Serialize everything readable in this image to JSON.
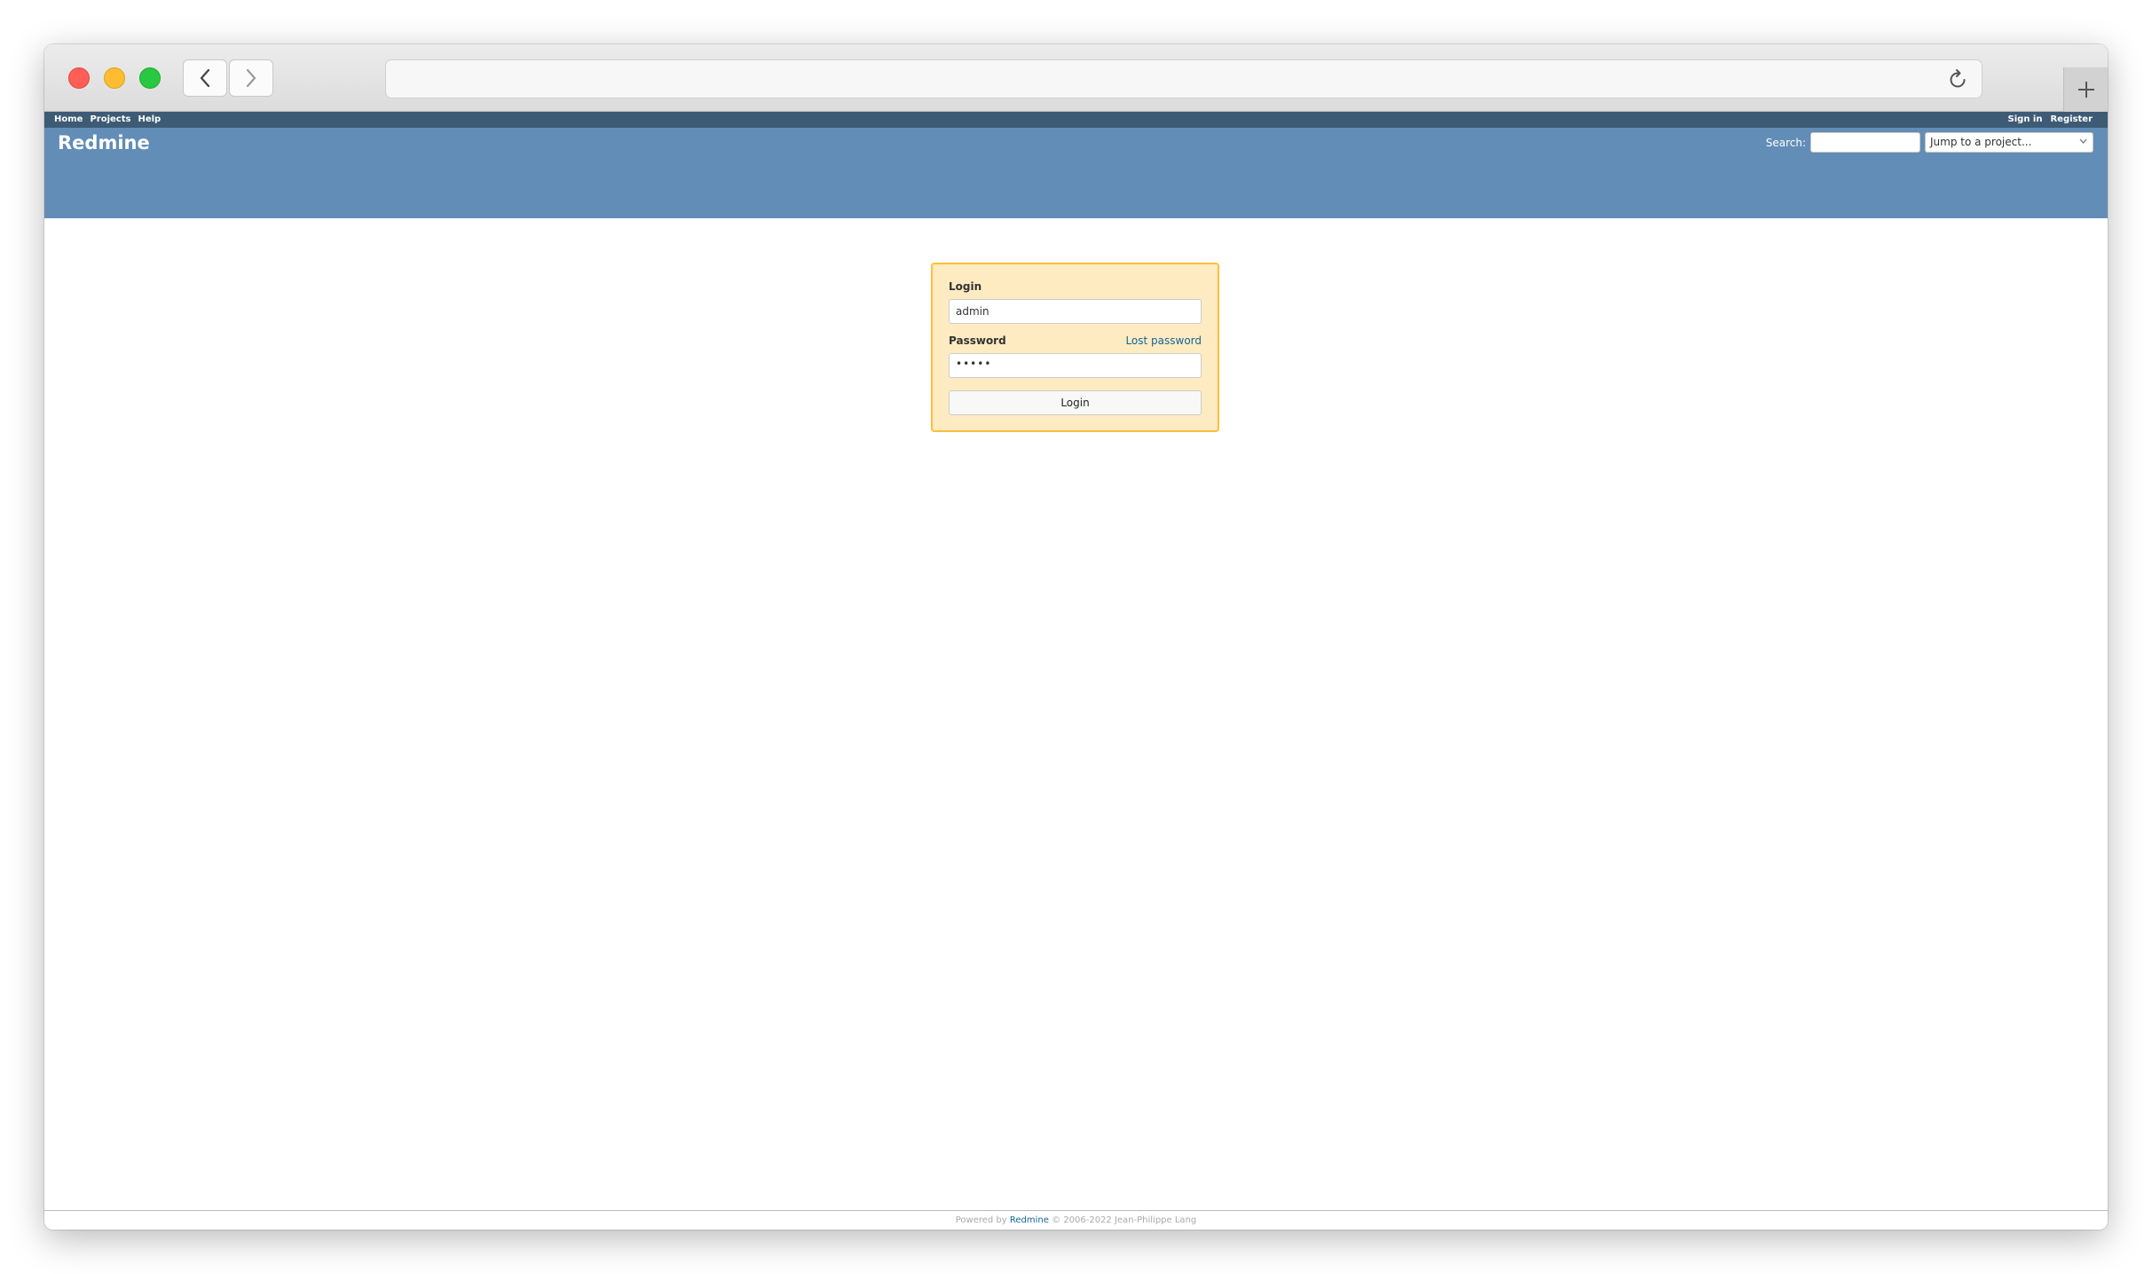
{
  "colors": {
    "top_menu_bg": "#3e5b76",
    "header_bg": "#628db6",
    "login_box_bg": "#ffebc1",
    "login_box_border": "#fdbf3b",
    "link": "#116699"
  },
  "browser": {
    "icons": {
      "back": "chevron-left-icon",
      "forward": "chevron-right-icon",
      "reload": "reload-icon",
      "new_tab": "plus-icon"
    }
  },
  "top_menu": {
    "home": "Home",
    "projects": "Projects",
    "help": "Help",
    "sign_in": "Sign in",
    "register": "Register"
  },
  "header": {
    "title": "Redmine",
    "search_label": "Search:",
    "search_value": "",
    "project_jump": "Jump to a project..."
  },
  "login_form": {
    "login_label": "Login",
    "login_value": "admin",
    "password_label": "Password",
    "lost_password": "Lost password",
    "password_value": "•••••",
    "submit_label": "Login"
  },
  "footer": {
    "powered_by": "Powered by",
    "link": "Redmine",
    "copyright": "© 2006-2022 Jean-Philippe Lang"
  }
}
